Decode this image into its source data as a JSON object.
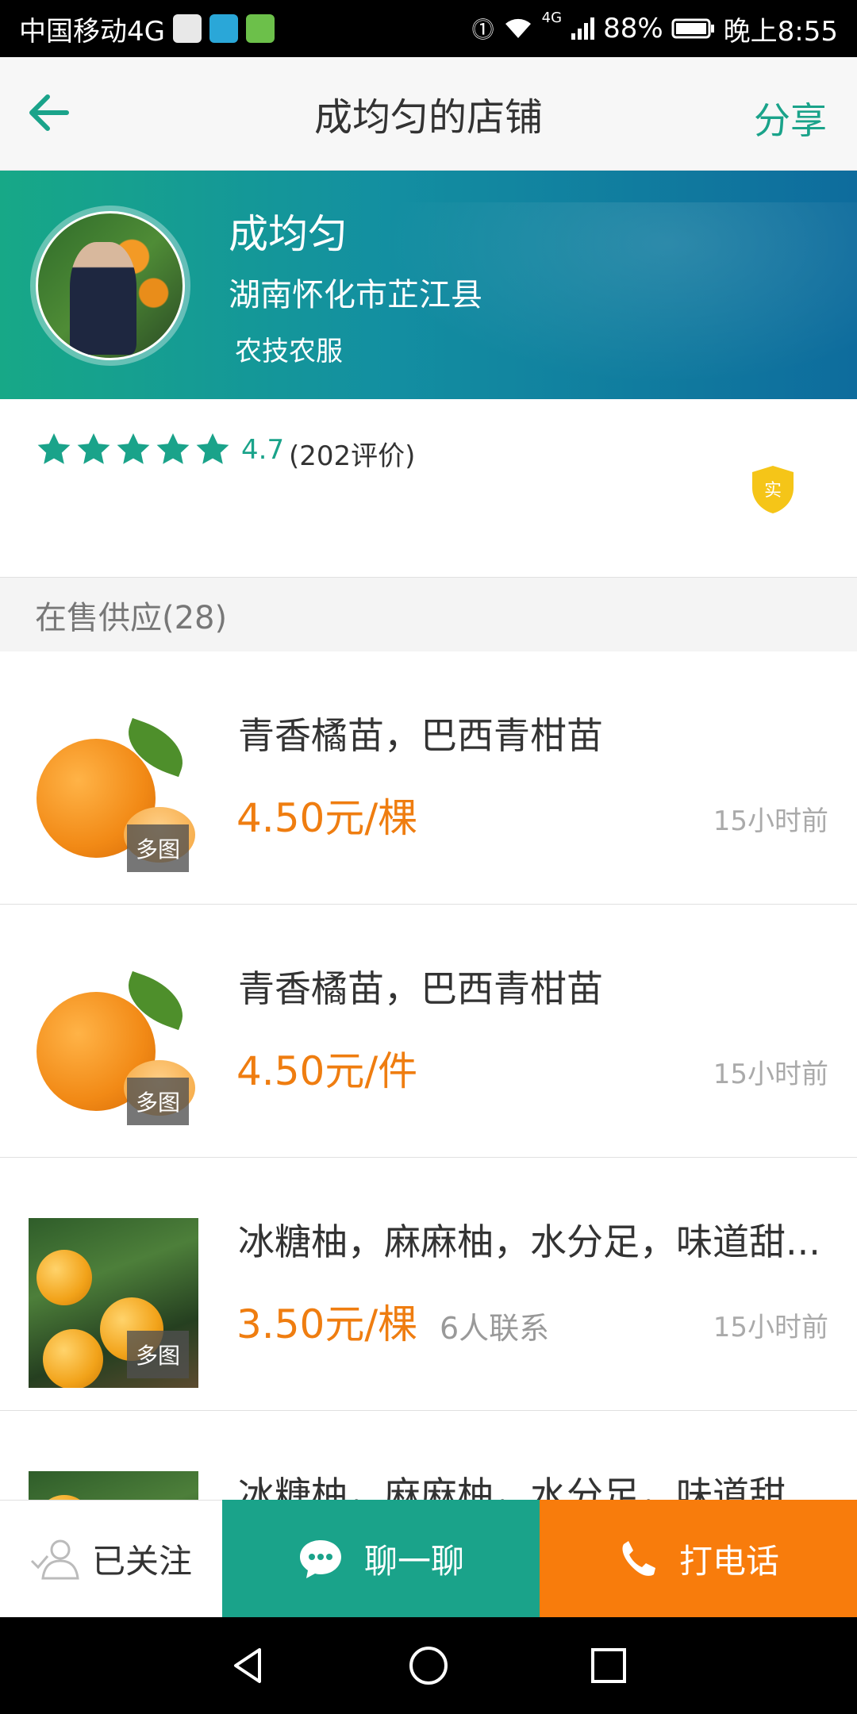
{
  "status_bar": {
    "carrier": "中国移动4G",
    "battery": "88%",
    "time": "晚上8:55",
    "network_label": "4G"
  },
  "header": {
    "title": "成均匀的店铺",
    "share_label": "分享"
  },
  "seller": {
    "name": "成均匀",
    "location": "湖南怀化市芷江县",
    "category": "农技农服"
  },
  "rating": {
    "stars_filled": 5,
    "score": "4.7",
    "count_label": "(202评价)",
    "verify_label": "实",
    "accent_color": "#1aa38a"
  },
  "section": {
    "title": "在售供应(28)"
  },
  "products": [
    {
      "title": "青香橘苗，巴西青柑苗",
      "price": "4.50元/棵",
      "contacts": "",
      "time": "15小时前",
      "badge": "多图",
      "image": "orange-fruit"
    },
    {
      "title": "青香橘苗，巴西青柑苗",
      "price": "4.50元/件",
      "contacts": "",
      "time": "15小时前",
      "badge": "多图",
      "image": "orange-fruit"
    },
    {
      "title": "冰糖柚，麻麻柚，水分足，味道甜...",
      "price": "3.50元/棵",
      "contacts": "6人联系",
      "time": "15小时前",
      "badge": "多图",
      "image": "orange-tree"
    },
    {
      "title": "冰糖柚，麻麻柚，水分足，味道甜...",
      "price": "",
      "contacts": "",
      "time": "",
      "badge": "",
      "image": "orange-tree"
    }
  ],
  "actions": {
    "follow_label": "已关注",
    "chat_label": "聊一聊",
    "call_label": "打电话",
    "chat_color": "#1aa38a",
    "call_color": "#f87c0c"
  },
  "colors": {
    "price": "#ef7d10",
    "banner_start": "#17a887",
    "banner_end": "#0e6c9d"
  }
}
